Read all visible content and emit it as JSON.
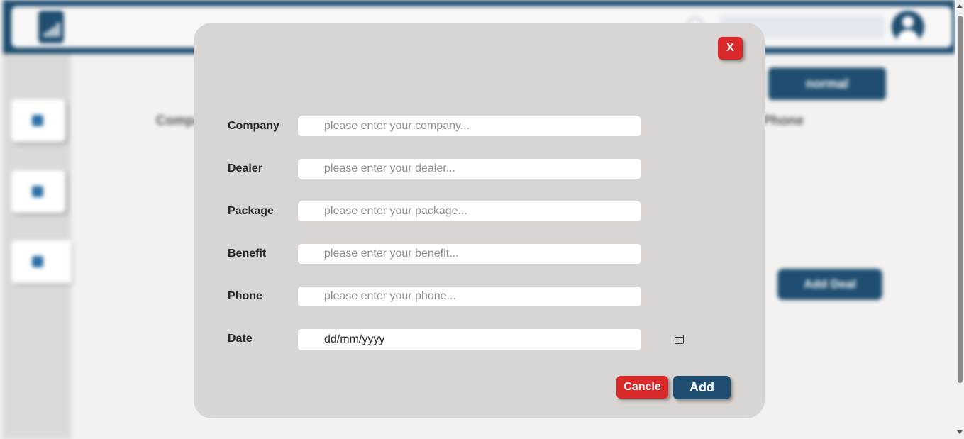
{
  "background": {
    "mode_select_label": "normal",
    "columns": [
      "Company",
      "Phone"
    ],
    "add_deal_label": "Add Deal"
  },
  "modal": {
    "close_label": "X",
    "fields": [
      {
        "label": "Company",
        "placeholder": "please enter your company..."
      },
      {
        "label": "Dealer",
        "placeholder": "please enter your dealer..."
      },
      {
        "label": "Package",
        "placeholder": "please enter your package..."
      },
      {
        "label": "Benefit",
        "placeholder": "please enter your benefit..."
      },
      {
        "label": "Phone",
        "placeholder": "please enter your phone..."
      }
    ],
    "date": {
      "label": "Date",
      "value": "dd/mm/yyyy"
    },
    "cancel_label": "Cancle",
    "add_label": "Add"
  },
  "icons": {
    "calendar": "calendar-icon",
    "search": "search-icon",
    "user": "user-avatar-icon",
    "logo": "bar-chart-logo"
  },
  "colors": {
    "primary": "#1f4e70",
    "danger": "#d9292b",
    "modal_bg": "#d9d5d2"
  }
}
